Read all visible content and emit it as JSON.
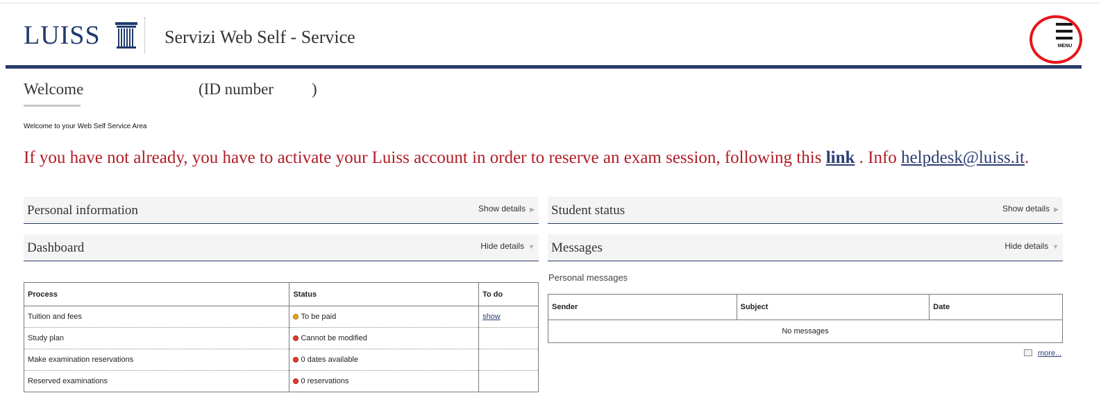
{
  "header": {
    "logo_text": "LUISS",
    "site_title": "Servizi Web Self - Service",
    "menu_label": "MENU"
  },
  "welcome": {
    "title": "Welcome",
    "id_label": "(ID number",
    "id_close": ")",
    "subtitle": "Welcome to your Web Self Service Area"
  },
  "alert": {
    "text_before": "If you have not already, you have to activate your Luiss account in order to reserve an exam session, following this ",
    "link_label": "link",
    "text_middle": " . Info ",
    "email": "helpdesk@luiss.it",
    "text_after": "."
  },
  "panels": {
    "personal_info": {
      "title": "Personal information",
      "toggle": "Show details"
    },
    "student_status": {
      "title": "Student status",
      "toggle": "Show details"
    },
    "dashboard": {
      "title": "Dashboard",
      "toggle": "Hide details"
    },
    "messages": {
      "title": "Messages",
      "toggle": "Hide details"
    }
  },
  "process_table": {
    "headers": [
      "Process",
      "Status",
      "To do"
    ],
    "rows": [
      {
        "process": "Tuition and fees",
        "status": "To be paid",
        "status_color": "yellow",
        "todo": "show"
      },
      {
        "process": "Study plan",
        "status": "Cannot be modified",
        "status_color": "red",
        "todo": ""
      },
      {
        "process": "Make examination reservations",
        "status": "0 dates available",
        "status_color": "red",
        "todo": ""
      },
      {
        "process": "Reserved examinations",
        "status": "0 reservations",
        "status_color": "red",
        "todo": ""
      }
    ]
  },
  "messages_table": {
    "caption": "Personal messages",
    "headers": [
      "Sender",
      "Subject",
      "Date"
    ],
    "empty_text": "No messages",
    "more_label": "more..."
  },
  "colors": {
    "brand_navy": "#283a66",
    "alert_red": "#b01c26",
    "highlight_circle": "#e8141b"
  }
}
